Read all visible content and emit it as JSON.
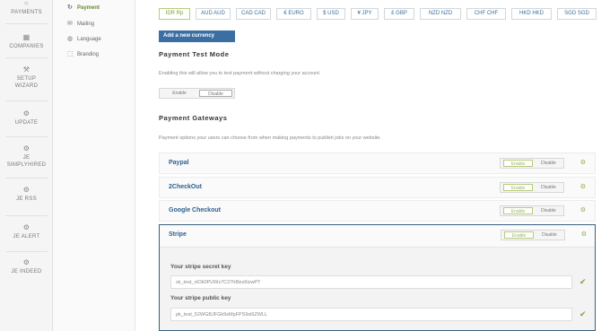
{
  "leftnav": {
    "payments": "PAYMENTS",
    "companies": "COMPANIES",
    "setup1": "SETUP",
    "setup2": "WIZARD",
    "update": "UPDATE",
    "je1": "JE",
    "je2": "SIMPLYHIRED",
    "jerss": "JE RSS",
    "jealert": "JE ALERT",
    "jeindeed": "JE INDEED"
  },
  "subnav": {
    "payment": "Payment",
    "mailing": "Mailing",
    "language": "Language",
    "branding": "Branding"
  },
  "currencies": [
    "IDR Rp",
    "AUD AUD",
    "CAD CAD",
    "€ EURO",
    "$ USD",
    "¥ JPY",
    "£ GBP",
    "NZD NZD",
    "CHF CHF",
    "HKD HKD",
    "SGD SGD"
  ],
  "add_currency": "Add a new currency",
  "test_mode": {
    "title": "Payment Test Mode",
    "desc": "Enabling this will allow you to test payment without charging your account.",
    "enable": "Enable",
    "disable": "Disable"
  },
  "gateways": {
    "title": "Payment Gateways",
    "desc": "Payment options your users can choose from when making payments to publish jobs on your website.",
    "enable": "Enable",
    "disable": "Disable",
    "paypal": "Paypal",
    "checkout": "2CheckOut",
    "google": "Google Checkout",
    "stripe": "Stripe"
  },
  "stripe": {
    "secret_label": "Your stripe secret key",
    "secret_value": "sk_test_vlOk0PUWz7C27h8tzs6izwPT",
    "public_label": "Your stripe public key",
    "public_value": "pk_test_52WGBJFGk9sMpFPS9sl6ZWLL"
  }
}
